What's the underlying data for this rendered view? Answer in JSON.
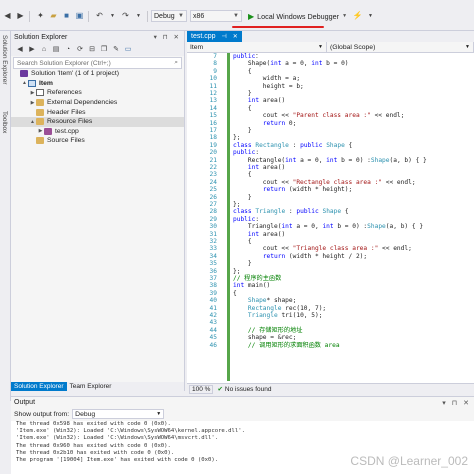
{
  "toolbar": {
    "config": "Debug",
    "platform": "x86",
    "run_label": "Local Windows Debugger",
    "run_icon": "play-icon",
    "accent": "#e02020"
  },
  "side_strip": {
    "top": "Solution Explorer",
    "bottom": "Toolbox"
  },
  "solution_explorer": {
    "title": "Solution Explorer",
    "search_placeholder": "Search Solution Explorer (Ctrl+;)",
    "tree": [
      {
        "label": "Solution 'Item' (1 of 1 project)",
        "icon": "solution-icon",
        "indent": 0,
        "expander": ""
      },
      {
        "label": "Item",
        "icon": "project-icon",
        "indent": 1,
        "expander": "▲",
        "bold": true
      },
      {
        "label": "References",
        "icon": "references-icon",
        "indent": 2,
        "expander": "▶"
      },
      {
        "label": "External Dependencies",
        "icon": "folder-icon",
        "indent": 2,
        "expander": "▶"
      },
      {
        "label": "Header Files",
        "icon": "folder-icon",
        "indent": 2,
        "expander": ""
      },
      {
        "label": "Resource Files",
        "icon": "folder-icon",
        "indent": 2,
        "expander": "▲",
        "selected": true
      },
      {
        "label": "test.cpp",
        "icon": "cpp-file-icon",
        "indent": 3,
        "expander": "▶"
      },
      {
        "label": "Source Files",
        "icon": "folder-icon",
        "indent": 2,
        "expander": ""
      }
    ],
    "tabs": [
      "Solution Explorer",
      "Team Explorer"
    ]
  },
  "editor": {
    "tab_name": "test.cpp",
    "nav_left": "Item",
    "nav_right": "(Global Scope)",
    "zoom": "100 %",
    "status": "No issues found",
    "lines": [
      {
        "n": 7,
        "parts": [
          [
            "kw",
            "public"
          ],
          [
            "",
            "："
          ]
        ]
      },
      {
        "n": 8,
        "parts": [
          [
            "",
            "    Shape("
          ],
          [
            "kw",
            "int"
          ],
          [
            "",
            " a = 0, "
          ],
          [
            "kw",
            "int"
          ],
          [
            "",
            " b = 0)"
          ]
        ]
      },
      {
        "n": 9,
        "parts": [
          [
            "",
            "    {"
          ]
        ]
      },
      {
        "n": 10,
        "parts": [
          [
            "",
            "        width = a;"
          ]
        ]
      },
      {
        "n": 11,
        "parts": [
          [
            "",
            "        height = b;"
          ]
        ]
      },
      {
        "n": 12,
        "parts": [
          [
            "",
            "    }"
          ]
        ]
      },
      {
        "n": 13,
        "parts": [
          [
            "",
            "    "
          ],
          [
            "kw",
            "int"
          ],
          [
            "",
            " area()"
          ]
        ]
      },
      {
        "n": 14,
        "parts": [
          [
            "",
            "    {"
          ]
        ]
      },
      {
        "n": 15,
        "parts": [
          [
            "",
            "        cout << "
          ],
          [
            "st",
            "\"Parent class area :\""
          ],
          [
            "",
            " << endl;"
          ]
        ]
      },
      {
        "n": 16,
        "parts": [
          [
            "",
            "        "
          ],
          [
            "kw",
            "return"
          ],
          [
            "",
            " 0;"
          ]
        ]
      },
      {
        "n": 17,
        "parts": [
          [
            "",
            "    }"
          ]
        ]
      },
      {
        "n": 18,
        "parts": [
          [
            "",
            "};"
          ]
        ]
      },
      {
        "n": 19,
        "parts": [
          [
            "kw",
            "class"
          ],
          [
            "",
            " "
          ],
          [
            "ty",
            "Rectangle"
          ],
          [
            "",
            " : "
          ],
          [
            "kw",
            "public"
          ],
          [
            "",
            " "
          ],
          [
            "ty",
            "Shape"
          ],
          [
            "",
            " {"
          ]
        ]
      },
      {
        "n": 20,
        "parts": [
          [
            "kw",
            "public"
          ],
          [
            "",
            ":"
          ]
        ]
      },
      {
        "n": 21,
        "parts": [
          [
            "",
            "    Rectangle("
          ],
          [
            "kw",
            "int"
          ],
          [
            "",
            " a = 0, "
          ],
          [
            "kw",
            "int"
          ],
          [
            "",
            " b = 0) :"
          ],
          [
            "ty",
            "Shape"
          ],
          [
            "",
            "(a, b) { }"
          ]
        ]
      },
      {
        "n": 22,
        "parts": [
          [
            "",
            "    "
          ],
          [
            "kw",
            "int"
          ],
          [
            "",
            " area()"
          ]
        ]
      },
      {
        "n": 23,
        "parts": [
          [
            "",
            "    {"
          ]
        ]
      },
      {
        "n": 24,
        "parts": [
          [
            "",
            "        cout << "
          ],
          [
            "st",
            "\"Rectangle class area :\""
          ],
          [
            "",
            " << endl;"
          ]
        ]
      },
      {
        "n": 25,
        "parts": [
          [
            "",
            "        "
          ],
          [
            "kw",
            "return"
          ],
          [
            "",
            " (width * height);"
          ]
        ]
      },
      {
        "n": 26,
        "parts": [
          [
            "",
            "    }"
          ]
        ]
      },
      {
        "n": 27,
        "parts": [
          [
            "",
            "};"
          ]
        ]
      },
      {
        "n": 28,
        "parts": [
          [
            "kw",
            "class"
          ],
          [
            "",
            " "
          ],
          [
            "ty",
            "Triangle"
          ],
          [
            "",
            " : "
          ],
          [
            "kw",
            "public"
          ],
          [
            "",
            " "
          ],
          [
            "ty",
            "Shape"
          ],
          [
            "",
            " {"
          ]
        ]
      },
      {
        "n": 29,
        "parts": [
          [
            "kw",
            "public"
          ],
          [
            "",
            ":"
          ]
        ]
      },
      {
        "n": 30,
        "parts": [
          [
            "",
            "    Triangle("
          ],
          [
            "kw",
            "int"
          ],
          [
            "",
            " a = 0, "
          ],
          [
            "kw",
            "int"
          ],
          [
            "",
            " b = 0) :"
          ],
          [
            "ty",
            "Shape"
          ],
          [
            "",
            "(a, b) { }"
          ]
        ]
      },
      {
        "n": 31,
        "parts": [
          [
            "",
            "    "
          ],
          [
            "kw",
            "int"
          ],
          [
            "",
            " area()"
          ]
        ]
      },
      {
        "n": 32,
        "parts": [
          [
            "",
            "    {"
          ]
        ]
      },
      {
        "n": 33,
        "parts": [
          [
            "",
            "        cout << "
          ],
          [
            "st",
            "\"Triangle class area :\""
          ],
          [
            "",
            " << endl;"
          ]
        ]
      },
      {
        "n": 34,
        "parts": [
          [
            "",
            "        "
          ],
          [
            "kw",
            "return"
          ],
          [
            "",
            " (width * height / 2);"
          ]
        ]
      },
      {
        "n": 35,
        "parts": [
          [
            "",
            "    }"
          ]
        ]
      },
      {
        "n": 36,
        "parts": [
          [
            "",
            "};"
          ]
        ]
      },
      {
        "n": 37,
        "parts": [
          [
            "cm",
            "// 程序的主函数"
          ]
        ]
      },
      {
        "n": 38,
        "parts": [
          [
            "kw",
            "int"
          ],
          [
            "",
            " main()"
          ]
        ]
      },
      {
        "n": 39,
        "parts": [
          [
            "",
            "{"
          ]
        ]
      },
      {
        "n": 40,
        "parts": [
          [
            "",
            "    "
          ],
          [
            "ty",
            "Shape"
          ],
          [
            "",
            "* shape;"
          ]
        ]
      },
      {
        "n": 41,
        "parts": [
          [
            "",
            "    "
          ],
          [
            "ty",
            "Rectangle"
          ],
          [
            "",
            " rec(10, 7);"
          ]
        ]
      },
      {
        "n": 42,
        "parts": [
          [
            "",
            "    "
          ],
          [
            "ty",
            "Triangle"
          ],
          [
            "",
            " tri(10, 5);"
          ]
        ]
      },
      {
        "n": 43,
        "parts": [
          [
            "",
            ""
          ]
        ]
      },
      {
        "n": 44,
        "parts": [
          [
            "",
            "    "
          ],
          [
            "cm",
            "// 存储矩形的地址"
          ]
        ]
      },
      {
        "n": 45,
        "parts": [
          [
            "",
            "    shape = &rec;"
          ]
        ]
      },
      {
        "n": 46,
        "parts": [
          [
            "",
            "    "
          ],
          [
            "cm",
            "// 调用矩形的求面积函数 area"
          ]
        ]
      }
    ]
  },
  "output": {
    "title": "Output",
    "show_from_label": "Show output from:",
    "source": "Debug",
    "lines": [
      "The thread 0x598 has exited with code 0 (0x0).",
      "'Item.exe' (Win32): Loaded 'C:\\Windows\\SysWOW64\\kernel.appcore.dll'.",
      "'Item.exe' (Win32): Loaded 'C:\\Windows\\SysWOW64\\msvcrt.dll'.",
      "The thread 0x960 has exited with code 0 (0x0).",
      "The thread 0x2b10 has exited with code 0 (0x0).",
      "The program '[19004] Item.exe' has exited with code 0 (0x0)."
    ],
    "watermark": "CSDN @Learner_002"
  }
}
